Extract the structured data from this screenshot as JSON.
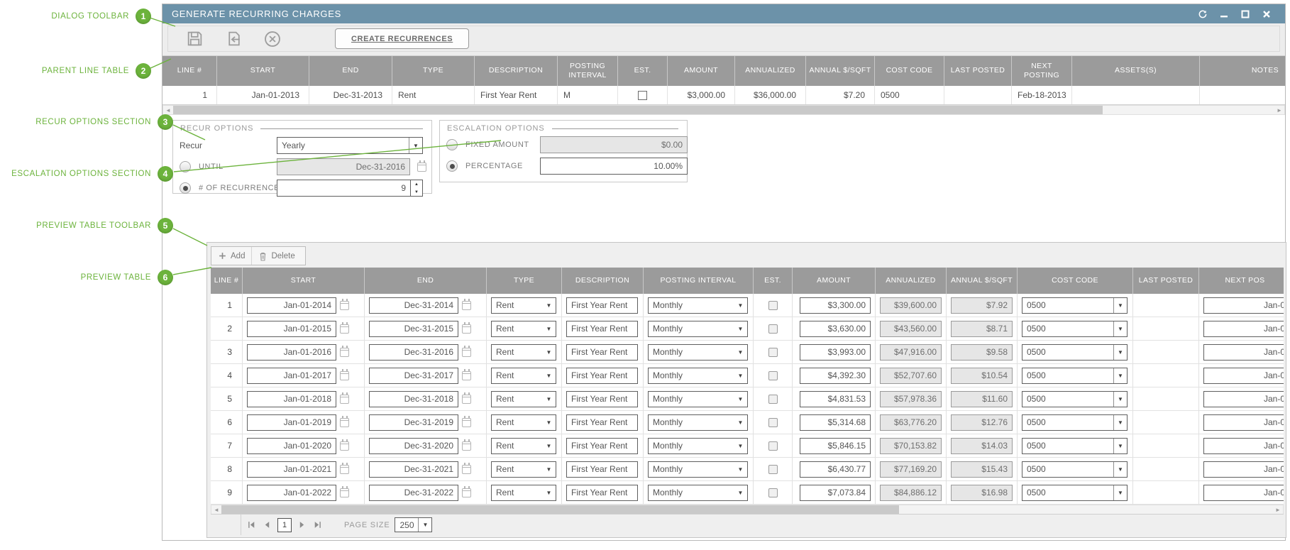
{
  "colors": {
    "annotation_green": "#6cb33c",
    "titlebar_blue": "#6c92a9",
    "table_header_gray": "#9b9b9b"
  },
  "annotations": [
    {
      "number": "1",
      "label": "DIALOG TOOLBAR"
    },
    {
      "number": "2",
      "label": "PARENT LINE TABLE"
    },
    {
      "number": "3",
      "label": "RECUR OPTIONS SECTION"
    },
    {
      "number": "4",
      "label": "ESCALATION OPTIONS SECTION"
    },
    {
      "number": "5",
      "label": "PREVIEW TABLE TOOLBAR"
    },
    {
      "number": "6",
      "label": "PREVIEW TABLE"
    }
  ],
  "window": {
    "title": "GENERATE RECURRING CHARGES"
  },
  "dialog_toolbar": {
    "create_recurrences_label": "CREATE RECURRENCES"
  },
  "parent_table": {
    "columns": [
      "LINE #",
      "START",
      "END",
      "TYPE",
      "DESCRIPTION",
      "POSTING INTERVAL",
      "EST.",
      "AMOUNT",
      "ANNUALIZED",
      "ANNUAL $/SQFT",
      "COST CODE",
      "LAST POSTED",
      "NEXT POSTING",
      "ASSETS(S)",
      "NOTES"
    ],
    "row": {
      "line": "1",
      "start": "Jan-01-2013",
      "end": "Dec-31-2013",
      "type": "Rent",
      "description": "First Year Rent",
      "posting_interval": "M",
      "est": false,
      "amount": "$3,000.00",
      "annualized": "$36,000.00",
      "annual_sqft": "$7.20",
      "cost_code": "0500",
      "last_posted": "",
      "next_posting": "Feb-18-2013",
      "assets": "",
      "notes": ""
    }
  },
  "recur_options": {
    "title": "RECUR OPTIONS",
    "recur_label": "Recur",
    "recur_value": "Yearly",
    "until_label": "UNTIL",
    "until_selected": false,
    "until_value": "Dec-31-2016",
    "recurrences_label": "# OF RECURRENCES",
    "recurrences_selected": true,
    "recurrences_value": "9"
  },
  "escalation_options": {
    "title": "ESCALATION OPTIONS",
    "fixed_amount_label": "FIXED AMOUNT",
    "fixed_amount_selected": false,
    "fixed_amount_value": "$0.00",
    "percentage_label": "PERCENTAGE",
    "percentage_selected": true,
    "percentage_value": "10.00%"
  },
  "preview": {
    "toolbar": {
      "add_label": "Add",
      "delete_label": "Delete"
    },
    "columns": [
      "LINE #",
      "START",
      "END",
      "TYPE",
      "DESCRIPTION",
      "POSTING INTERVAL",
      "EST.",
      "AMOUNT",
      "ANNUALIZED",
      "ANNUAL $/SQFT",
      "COST CODE",
      "LAST POSTED",
      "NEXT POS"
    ],
    "rows": [
      {
        "line": "1",
        "start": "Jan-01-2014",
        "end": "Dec-31-2014",
        "type": "Rent",
        "description": "First Year Rent",
        "interval": "Monthly",
        "est": false,
        "amount": "$3,300.00",
        "annualized": "$39,600.00",
        "annual_sqft": "$7.92",
        "cost_code": "0500",
        "last_posted": "",
        "next_posting": "Jan-0"
      },
      {
        "line": "2",
        "start": "Jan-01-2015",
        "end": "Dec-31-2015",
        "type": "Rent",
        "description": "First Year Rent",
        "interval": "Monthly",
        "est": false,
        "amount": "$3,630.00",
        "annualized": "$43,560.00",
        "annual_sqft": "$8.71",
        "cost_code": "0500",
        "last_posted": "",
        "next_posting": "Jan-0"
      },
      {
        "line": "3",
        "start": "Jan-01-2016",
        "end": "Dec-31-2016",
        "type": "Rent",
        "description": "First Year Rent",
        "interval": "Monthly",
        "est": false,
        "amount": "$3,993.00",
        "annualized": "$47,916.00",
        "annual_sqft": "$9.58",
        "cost_code": "0500",
        "last_posted": "",
        "next_posting": "Jan-0"
      },
      {
        "line": "4",
        "start": "Jan-01-2017",
        "end": "Dec-31-2017",
        "type": "Rent",
        "description": "First Year Rent",
        "interval": "Monthly",
        "est": false,
        "amount": "$4,392.30",
        "annualized": "$52,707.60",
        "annual_sqft": "$10.54",
        "cost_code": "0500",
        "last_posted": "",
        "next_posting": "Jan-0"
      },
      {
        "line": "5",
        "start": "Jan-01-2018",
        "end": "Dec-31-2018",
        "type": "Rent",
        "description": "First Year Rent",
        "interval": "Monthly",
        "est": false,
        "amount": "$4,831.53",
        "annualized": "$57,978.36",
        "annual_sqft": "$11.60",
        "cost_code": "0500",
        "last_posted": "",
        "next_posting": "Jan-0"
      },
      {
        "line": "6",
        "start": "Jan-01-2019",
        "end": "Dec-31-2019",
        "type": "Rent",
        "description": "First Year Rent",
        "interval": "Monthly",
        "est": false,
        "amount": "$5,314.68",
        "annualized": "$63,776.20",
        "annual_sqft": "$12.76",
        "cost_code": "0500",
        "last_posted": "",
        "next_posting": "Jan-0"
      },
      {
        "line": "7",
        "start": "Jan-01-2020",
        "end": "Dec-31-2020",
        "type": "Rent",
        "description": "First Year Rent",
        "interval": "Monthly",
        "est": false,
        "amount": "$5,846.15",
        "annualized": "$70,153.82",
        "annual_sqft": "$14.03",
        "cost_code": "0500",
        "last_posted": "",
        "next_posting": "Jan-0"
      },
      {
        "line": "8",
        "start": "Jan-01-2021",
        "end": "Dec-31-2021",
        "type": "Rent",
        "description": "First Year Rent",
        "interval": "Monthly",
        "est": false,
        "amount": "$6,430.77",
        "annualized": "$77,169.20",
        "annual_sqft": "$15.43",
        "cost_code": "0500",
        "last_posted": "",
        "next_posting": "Jan-0"
      },
      {
        "line": "9",
        "start": "Jan-01-2022",
        "end": "Dec-31-2022",
        "type": "Rent",
        "description": "First Year Rent",
        "interval": "Monthly",
        "est": false,
        "amount": "$7,073.84",
        "annualized": "$84,886.12",
        "annual_sqft": "$16.98",
        "cost_code": "0500",
        "last_posted": "",
        "next_posting": "Jan-0"
      }
    ],
    "pager": {
      "page": "1",
      "page_size_label": "PAGE SIZE",
      "page_size": "250"
    }
  },
  "icons": {
    "save": "floppy-disk",
    "export": "document-arrow-left",
    "cancel": "circle-x",
    "refresh": "circular-arrows",
    "minimize": "dash",
    "maximize": "square",
    "close": "x",
    "add": "plus",
    "delete": "trash",
    "calendar": "calendar",
    "dropdown": "▼",
    "spinner": "▲▼",
    "scroll_left": "◄",
    "scroll_right": "►",
    "pager_first": "bar-left-triangle",
    "pager_prev": "left-triangle",
    "pager_next": "right-triangle",
    "pager_last": "right-triangle-bar"
  }
}
